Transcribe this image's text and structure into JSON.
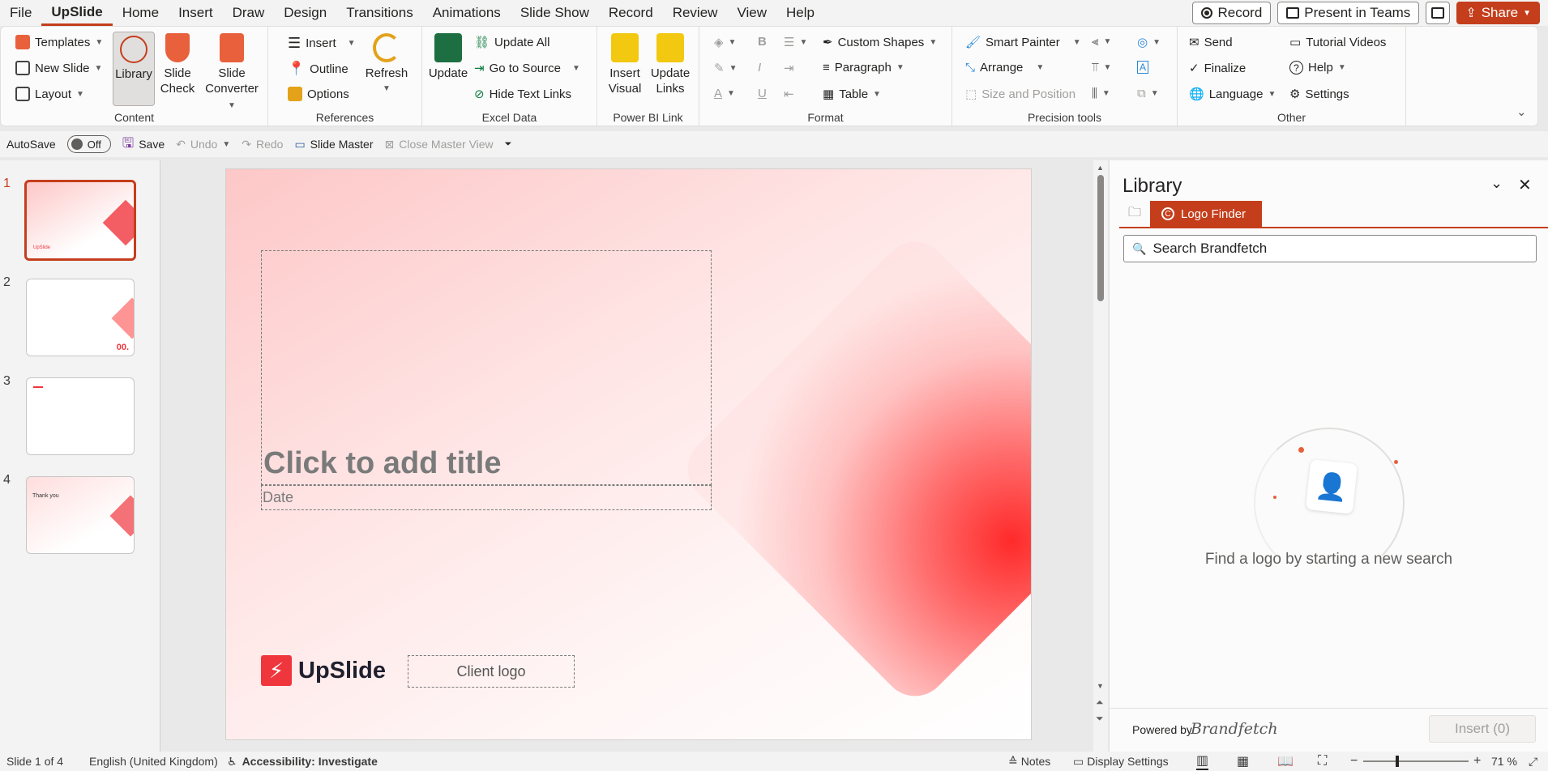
{
  "menu": {
    "tabs": [
      "File",
      "UpSlide",
      "Home",
      "Insert",
      "Draw",
      "Design",
      "Transitions",
      "Animations",
      "Slide Show",
      "Record",
      "Review",
      "View",
      "Help"
    ],
    "record_label": "Record",
    "present_label": "Present in Teams",
    "share_label": "Share"
  },
  "ribbon": {
    "content": {
      "label": "Content",
      "templates": "Templates",
      "new_slide": "New Slide",
      "layout": "Layout",
      "library": "Library",
      "slide_check_1": "Slide",
      "slide_check_2": "Check",
      "slide_converter_1": "Slide",
      "slide_converter_2": "Converter"
    },
    "references": {
      "label": "References",
      "insert": "Insert",
      "outline": "Outline",
      "options": "Options",
      "refresh": "Refresh"
    },
    "excel": {
      "label": "Excel Data",
      "update": "Update",
      "update_all": "Update All",
      "go_to_source": "Go to Source",
      "hide_text_links": "Hide Text Links"
    },
    "powerbi": {
      "label": "Power BI Link",
      "insert_visual_1": "Insert",
      "insert_visual_2": "Visual",
      "update_links_1": "Update",
      "update_links_2": "Links"
    },
    "format": {
      "label": "Format",
      "custom_shapes": "Custom Shapes",
      "paragraph": "Paragraph",
      "table": "Table"
    },
    "precision": {
      "label": "Precision tools",
      "smart_painter": "Smart Painter",
      "arrange": "Arrange",
      "size_position": "Size and Position"
    },
    "other": {
      "label": "Other",
      "send": "Send",
      "finalize": "Finalize",
      "language": "Language",
      "tutorial": "Tutorial Videos",
      "help": "Help",
      "settings": "Settings"
    }
  },
  "qat": {
    "autosave": "AutoSave",
    "autosave_state": "Off",
    "save": "Save",
    "undo": "Undo",
    "redo": "Redo",
    "slide_master": "Slide Master",
    "close_master": "Close Master View"
  },
  "thumbnails": [
    {
      "num": "1",
      "selected": true
    },
    {
      "num": "2",
      "selected": false,
      "label": "00."
    },
    {
      "num": "3",
      "selected": false
    },
    {
      "num": "4",
      "selected": false,
      "label": "Thank you"
    }
  ],
  "slide": {
    "title_placeholder": "Click to add title",
    "date_placeholder": "Date",
    "brand_name": "UpSlide",
    "client_logo": "Client logo",
    "mini_brand": "UpSlide"
  },
  "library": {
    "title": "Library",
    "tab_logo_finder": "Logo Finder",
    "search_value": "Search Brandfetch",
    "empty_message": "Find a logo by starting a new search",
    "powered_by": "Powered by",
    "brand": "Brandfetch",
    "insert_button": "Insert (0)"
  },
  "status": {
    "slide_info": "Slide 1 of 4",
    "language": "English (United Kingdom)",
    "accessibility": "Accessibility: Investigate",
    "notes": "Notes",
    "display_settings": "Display Settings",
    "zoom": "71 %"
  },
  "colors": {
    "accent": "#c43e1c",
    "brand_red": "#f0363d"
  }
}
